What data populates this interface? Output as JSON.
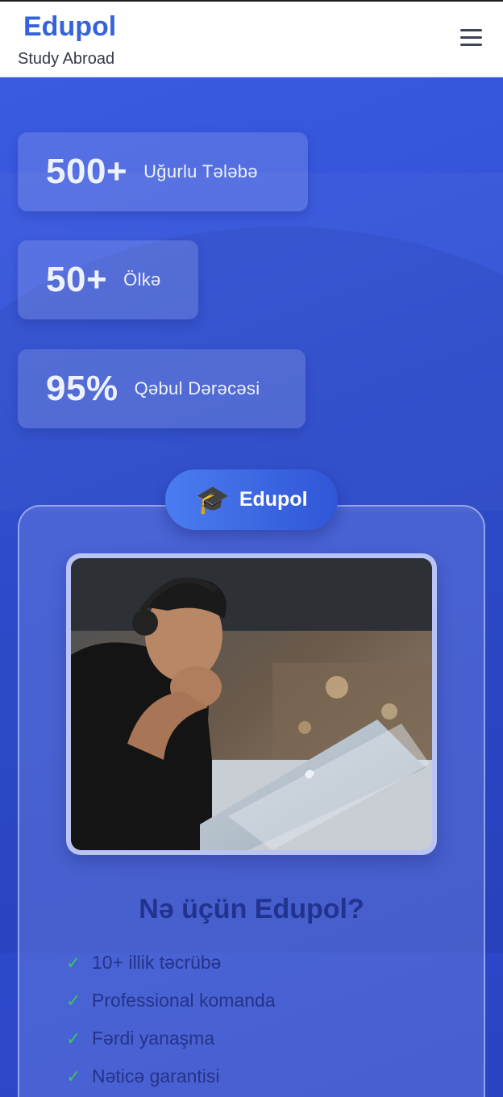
{
  "header": {
    "brand_name": "Edupol",
    "brand_subtitle": "Study Abroad",
    "menu_icon": "hamburger-menu-icon"
  },
  "stats": [
    {
      "number": "500+",
      "label": "Uğurlu Tələbə"
    },
    {
      "number": "50+",
      "label": "Ölkə"
    },
    {
      "number": "95%",
      "label": "Qəbul Dərəcəsi"
    }
  ],
  "badge": {
    "icon": "graduation-cap-icon",
    "label": "Edupol"
  },
  "why": {
    "title": "Nə üçün Edupol?",
    "items": [
      "10+ illik təcrübə",
      "Professional komanda",
      "Fərdi yanaşma",
      "Nəticə garantisi"
    ],
    "check_icon": "check-icon",
    "check_color": "#3fc163"
  },
  "colors": {
    "brand": "#3563d9",
    "hero_bg": "#2f4fd0",
    "heading": "#22338f"
  }
}
